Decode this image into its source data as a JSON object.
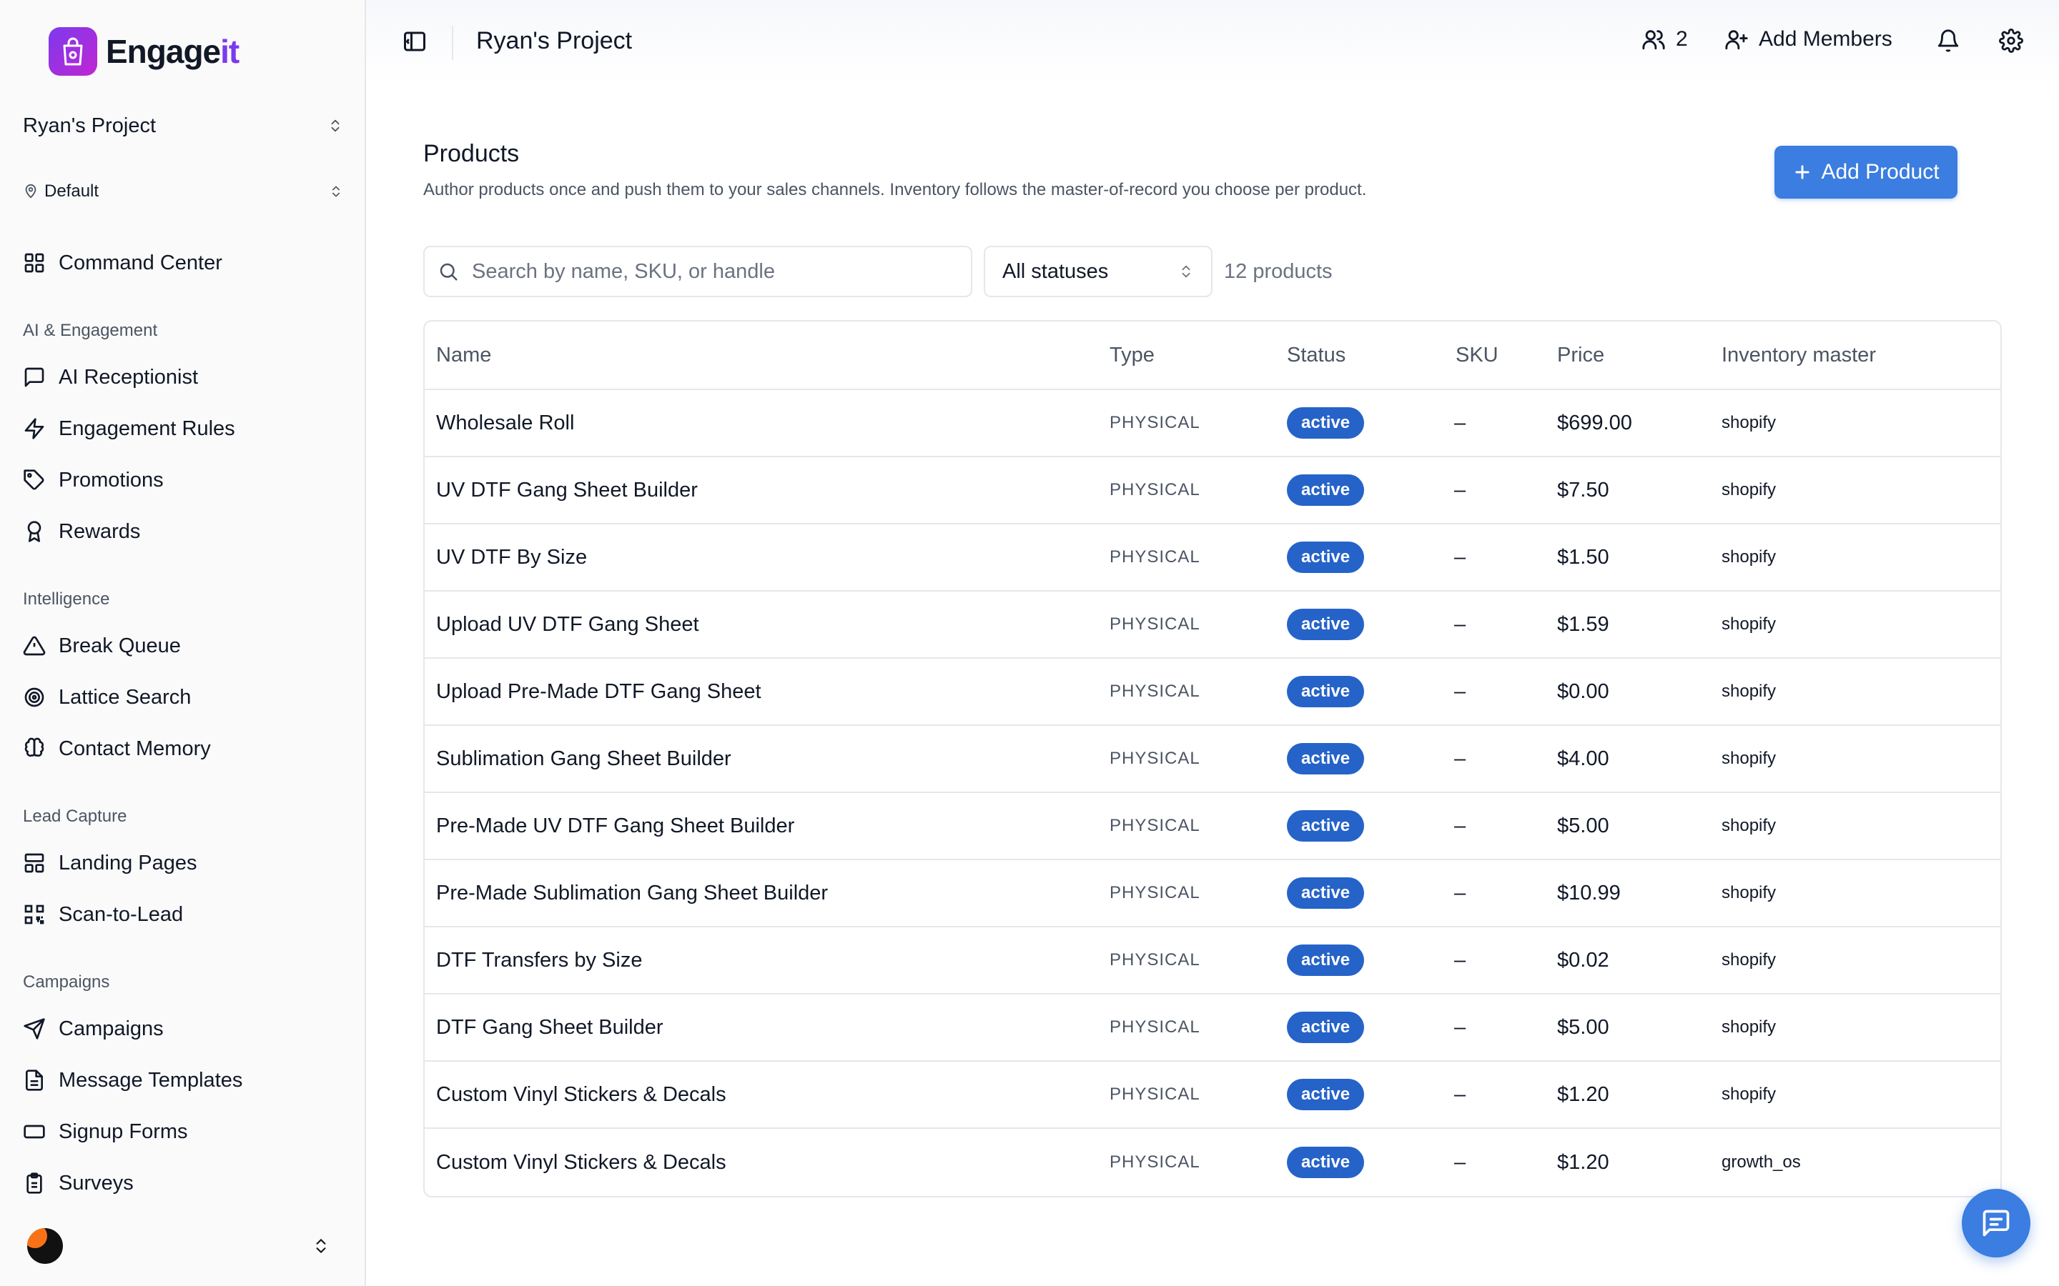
{
  "brand": {
    "name_main": "Engage",
    "name_accent": "it",
    "accent_color": "#7c3aed"
  },
  "sidebar": {
    "project": "Ryan's Project",
    "environment": "Default",
    "top_item": {
      "label": "Command Center",
      "icon": "grid-icon"
    },
    "sections": [
      {
        "heading": "AI & Engagement",
        "items": [
          {
            "label": "AI Receptionist",
            "icon": "message-square-icon"
          },
          {
            "label": "Engagement Rules",
            "icon": "zap-icon"
          },
          {
            "label": "Promotions",
            "icon": "tag-icon"
          },
          {
            "label": "Rewards",
            "icon": "award-icon"
          }
        ]
      },
      {
        "heading": "Intelligence",
        "items": [
          {
            "label": "Break Queue",
            "icon": "alert-triangle-icon"
          },
          {
            "label": "Lattice Search",
            "icon": "radar-icon"
          },
          {
            "label": "Contact Memory",
            "icon": "brain-icon"
          }
        ]
      },
      {
        "heading": "Lead Capture",
        "items": [
          {
            "label": "Landing Pages",
            "icon": "layout-icon"
          },
          {
            "label": "Scan-to-Lead",
            "icon": "qr-code-icon"
          }
        ]
      },
      {
        "heading": "Campaigns",
        "items": [
          {
            "label": "Campaigns",
            "icon": "send-icon"
          },
          {
            "label": "Message Templates",
            "icon": "file-text-icon"
          },
          {
            "label": "Signup Forms",
            "icon": "form-input-icon"
          },
          {
            "label": "Surveys",
            "icon": "clipboard-icon"
          }
        ]
      }
    ]
  },
  "topbar": {
    "title": "Ryan's Project",
    "member_count": "2",
    "add_members_label": "Add Members"
  },
  "page": {
    "title": "Products",
    "description": "Author products once and push them to your sales channels. Inventory follows the master-of-record you choose per product.",
    "add_button_label": "Add Product",
    "search_placeholder": "Search by name, SKU, or handle",
    "status_filter": "All statuses",
    "count_label": "12 products"
  },
  "table": {
    "columns": [
      "Name",
      "Type",
      "Status",
      "SKU",
      "Price",
      "Inventory master"
    ],
    "rows": [
      {
        "name": "Wholesale Roll",
        "type": "PHYSICAL",
        "status": "active",
        "sku": "–",
        "price": "$699.00",
        "inventory": "shopify"
      },
      {
        "name": "UV DTF Gang Sheet Builder",
        "type": "PHYSICAL",
        "status": "active",
        "sku": "–",
        "price": "$7.50",
        "inventory": "shopify"
      },
      {
        "name": "UV DTF By Size",
        "type": "PHYSICAL",
        "status": "active",
        "sku": "–",
        "price": "$1.50",
        "inventory": "shopify"
      },
      {
        "name": "Upload UV DTF Gang Sheet",
        "type": "PHYSICAL",
        "status": "active",
        "sku": "–",
        "price": "$1.59",
        "inventory": "shopify"
      },
      {
        "name": "Upload Pre-Made DTF Gang Sheet",
        "type": "PHYSICAL",
        "status": "active",
        "sku": "–",
        "price": "$0.00",
        "inventory": "shopify"
      },
      {
        "name": "Sublimation Gang Sheet Builder",
        "type": "PHYSICAL",
        "status": "active",
        "sku": "–",
        "price": "$4.00",
        "inventory": "shopify"
      },
      {
        "name": "Pre-Made UV DTF Gang Sheet Builder",
        "type": "PHYSICAL",
        "status": "active",
        "sku": "–",
        "price": "$5.00",
        "inventory": "shopify"
      },
      {
        "name": "Pre-Made Sublimation Gang Sheet Builder",
        "type": "PHYSICAL",
        "status": "active",
        "sku": "–",
        "price": "$10.99",
        "inventory": "shopify"
      },
      {
        "name": "DTF Transfers by Size",
        "type": "PHYSICAL",
        "status": "active",
        "sku": "–",
        "price": "$0.02",
        "inventory": "shopify"
      },
      {
        "name": "DTF Gang Sheet Builder",
        "type": "PHYSICAL",
        "status": "active",
        "sku": "–",
        "price": "$5.00",
        "inventory": "shopify"
      },
      {
        "name": "Custom Vinyl Stickers & Decals",
        "type": "PHYSICAL",
        "status": "active",
        "sku": "–",
        "price": "$1.20",
        "inventory": "shopify"
      },
      {
        "name": "Custom Vinyl Stickers & Decals",
        "type": "PHYSICAL",
        "status": "active",
        "sku": "–",
        "price": "$1.20",
        "inventory": "growth_os"
      }
    ]
  },
  "colors": {
    "primary": "#3b7de0",
    "badge": "#2563c9"
  }
}
